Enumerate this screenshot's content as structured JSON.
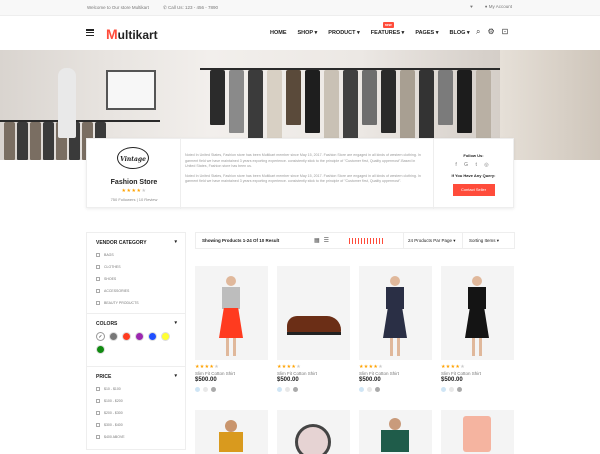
{
  "topbar": {
    "welcome": "Welcome to Our store Multikart",
    "phone": "Call Us: 123 - 456 - 7890",
    "account": "My Account"
  },
  "header": {
    "logo_initial": "M",
    "logo_rest": "ultikart",
    "nav": [
      {
        "label": "HOME"
      },
      {
        "label": "SHOP"
      },
      {
        "label": "PRODUCT"
      },
      {
        "label": "FEATURES",
        "badge": "new"
      },
      {
        "label": "PAGES"
      },
      {
        "label": "BLOG"
      }
    ]
  },
  "vendor": {
    "logo_text": "Vintage",
    "name": "Fashion Store",
    "rating": 4,
    "followers": "750 Followers | 10 Review",
    "desc": [
      "Noted In United States, Fashion store has been Multikart member since May 15, 2017. Fashion Store are engaged in all kinds of western clothing. In garment field we have maintained 3 years exporting experience. consistently stick to the principle of \"Customer first, Quality uppermost\".Based in United States, Fashion store has been us.",
      "Noted In United States, Fashion store has been Multikart member since May 15, 2017. Fashion Store are engaged in all kinds of western clothing. In garment field we have maintained 3 years exporting experience. consistently stick to the principle of \"Customer first, Quality uppermost\"."
    ],
    "follow_label": "Follow Us:",
    "query_label": "If You Have Any Query:",
    "contact_label": "Contact Seller"
  },
  "sidebar": {
    "category_title": "VENDOR CATEGORY",
    "categories": [
      "BAGS",
      "CLOTHES",
      "SHOES",
      "ACCESSORIES",
      "BEAUTY PRODUCTS"
    ],
    "colors_title": "COLORS",
    "colors": [
      "#ffffff",
      "#777777",
      "#ff3b1f",
      "#9c27b0",
      "#1f4fff",
      "#ffff33",
      "#108a10"
    ],
    "price_title": "PRICE",
    "prices": [
      "$10 - $100",
      "$100 - $200",
      "$200 - $300",
      "$300 - $400",
      "$400 ABOVE"
    ]
  },
  "toolbar": {
    "showing": "Showing Products 1-24 Of 10 Result",
    "per_page": "24 Products Par Page",
    "sorting": "Sorting Items"
  },
  "products": [
    {
      "rating": 4,
      "title": "Slim Fit Cotton Shirt",
      "price": "$500.00",
      "dots": [
        "#cfe5f5",
        "#e8e8e8",
        "#aaaaaa"
      ]
    },
    {
      "rating": 4,
      "title": "Slim Fit Cotton Shirt",
      "price": "$500.00",
      "dots": [
        "#cfe5f5",
        "#e8e8e8",
        "#aaaaaa"
      ]
    },
    {
      "rating": 4,
      "title": "Slim Fit Cotton Shirt",
      "price": "$500.00",
      "dots": [
        "#cfe5f5",
        "#e8e8e8",
        "#aaaaaa"
      ]
    },
    {
      "rating": 4,
      "title": "Slim Fit Cotton Shirt",
      "price": "$500.00",
      "dots": [
        "#cfe5f5",
        "#e8e8e8",
        "#aaaaaa"
      ]
    }
  ],
  "icons": {
    "search": "search-icon",
    "settings": "gear-icon",
    "cart": "cart-icon"
  }
}
